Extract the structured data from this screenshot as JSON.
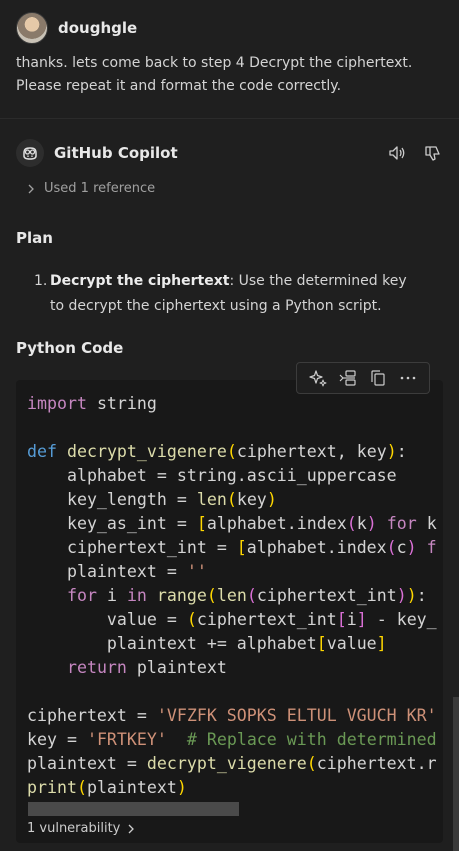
{
  "user": {
    "name": "doughgle",
    "message": "thanks. lets come back to step 4 Decrypt the ciphertext. Please repeat it and format the code correctly."
  },
  "assistant": {
    "name": "GitHub Copilot",
    "reference_label": "Used 1 reference",
    "plan_heading": "Plan",
    "plan_items": [
      {
        "number": "1.",
        "title": "Decrypt the ciphertext",
        "text": ": Use the determined key to decrypt the ciphertext using a Python script."
      }
    ],
    "code_heading": "Python Code",
    "code_lines": [
      "import string",
      "",
      "def decrypt_vigenere(ciphertext, key):",
      "    alphabet = string.ascii_uppercase",
      "    key_length = len(key)",
      "    key_as_int = [alphabet.index(k) for k",
      "    ciphertext_int = [alphabet.index(c) f",
      "    plaintext = ''",
      "    for i in range(len(ciphertext_int)):",
      "        value = (ciphertext_int[i] - key_",
      "        plaintext += alphabet[value]",
      "    return plaintext",
      "",
      "ciphertext = 'VFZFK SOPKS ELTUL VGUCH KR'",
      "key = 'FRTKEY'  # Replace with determined",
      "plaintext = decrypt_vigenere(ciphertext.r",
      "print(plaintext)"
    ],
    "vulnerability_label": "1 vulnerability"
  },
  "icons": {
    "copilot": "copilot-icon",
    "speaker": "speaker-icon",
    "thumbs_down": "thumbs-down-icon",
    "chevron": "chevron-right-icon",
    "sparkle": "sparkle-icon",
    "insert": "insert-at-cursor-icon",
    "copy": "copy-icon",
    "more": "more-icon"
  },
  "colors": {
    "background": "#1f1f1f",
    "code_background": "#181818",
    "keyword": "#569cd6",
    "control_keyword": "#c586c0",
    "function": "#dcdcaa",
    "string": "#ce9178",
    "comment": "#6a9955"
  }
}
